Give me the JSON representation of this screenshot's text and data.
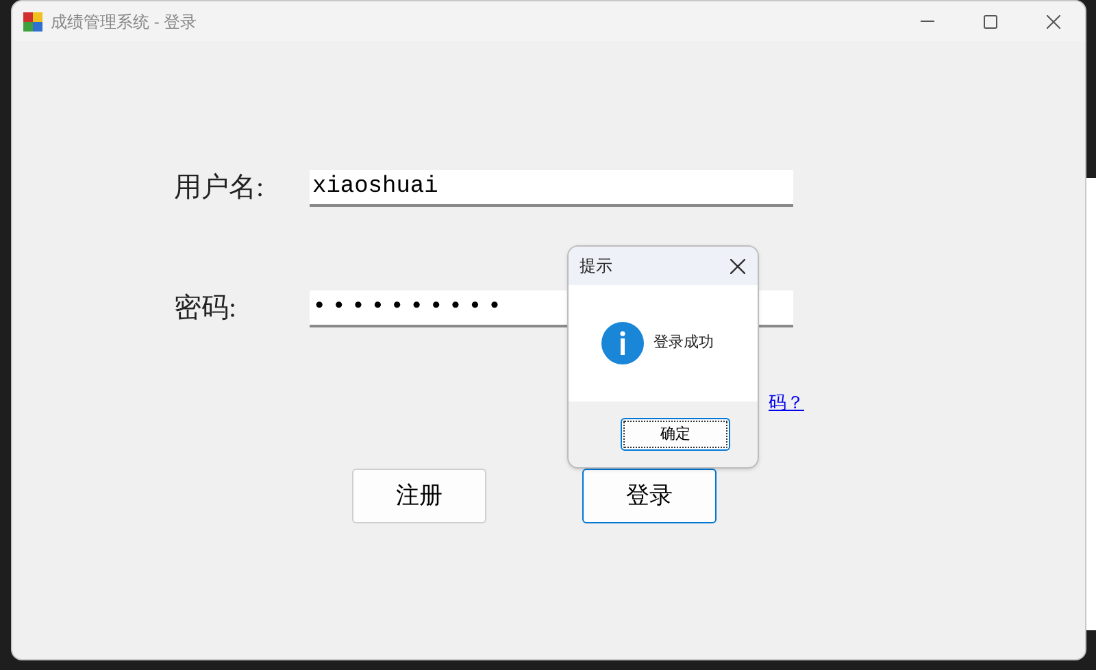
{
  "window": {
    "title": "成绩管理系统 - 登录"
  },
  "form": {
    "username": {
      "label": "用户名:",
      "value": "xiaoshuai"
    },
    "password": {
      "label": "密码:",
      "value": "••••••••••"
    },
    "link": "码？",
    "buttons": [
      {
        "label": "注册",
        "focused": false
      },
      {
        "label": "登录",
        "focused": true
      }
    ]
  },
  "dialog": {
    "title": "提示",
    "message": "登录成功",
    "button": "确定"
  }
}
